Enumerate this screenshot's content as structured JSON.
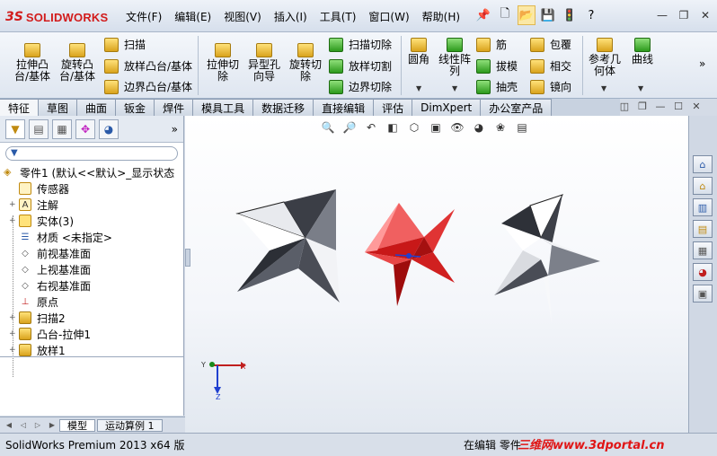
{
  "app": {
    "logo_ds": "3S",
    "logo_text": "SOLIDWORKS",
    "brand_color": "#d21b1b"
  },
  "menu": [
    "文件(F)",
    "编辑(E)",
    "视图(V)",
    "插入(I)",
    "工具(T)",
    "窗口(W)",
    "帮助(H)"
  ],
  "ribbon": {
    "extrude_boss": "拉伸凸\n台/基体",
    "revolve_boss": "旋转凸\n台/基体",
    "sweep": "扫描",
    "loft_boss": "放样凸台/基体",
    "boundary_boss": "边界凸台/基体",
    "extrude_cut": "拉伸切\n除",
    "hole_wizard": "异型孔\n向导",
    "revolve_cut": "旋转切\n除",
    "sweep_cut": "扫描切除",
    "loft_cut": "放样切割",
    "boundary_cut": "边界切除",
    "fillet": "圆角",
    "linear_pattern": "线性阵\n列",
    "rib": "筋",
    "draft": "拔模",
    "shell": "抽壳",
    "wrap": "包覆",
    "intersect": "相交",
    "mirror": "镜向",
    "ref_geometry": "参考几\n何体",
    "curves": "曲线"
  },
  "tabs": [
    "特征",
    "草图",
    "曲面",
    "钣金",
    "焊件",
    "模具工具",
    "数据迁移",
    "直接编辑",
    "评估",
    "DimXpert",
    "办公室产品"
  ],
  "active_tab": "特征",
  "tree": {
    "root": "零件1 (默认<<默认>_显示状态",
    "items": [
      {
        "label": "传感器",
        "expand": ""
      },
      {
        "label": "注解",
        "expand": "+"
      },
      {
        "label": "实体(3)",
        "expand": "+"
      },
      {
        "label": "材质 <未指定>",
        "expand": ""
      },
      {
        "label": "前视基准面",
        "expand": ""
      },
      {
        "label": "上视基准面",
        "expand": ""
      },
      {
        "label": "右视基准面",
        "expand": ""
      },
      {
        "label": "原点",
        "expand": ""
      },
      {
        "label": "扫描2",
        "expand": "+"
      },
      {
        "label": "凸台-拉伸1",
        "expand": "+"
      },
      {
        "label": "放样1",
        "expand": "+"
      }
    ]
  },
  "bottom_tabs": [
    "模型",
    "运动算例 1"
  ],
  "axes": {
    "x": "X",
    "y": "Y",
    "z": "Z"
  },
  "status": {
    "left": "SolidWorks Premium 2013 x64 版",
    "mid": "在编辑 零件",
    "watermark": "三维网www.3dportal.cn"
  }
}
